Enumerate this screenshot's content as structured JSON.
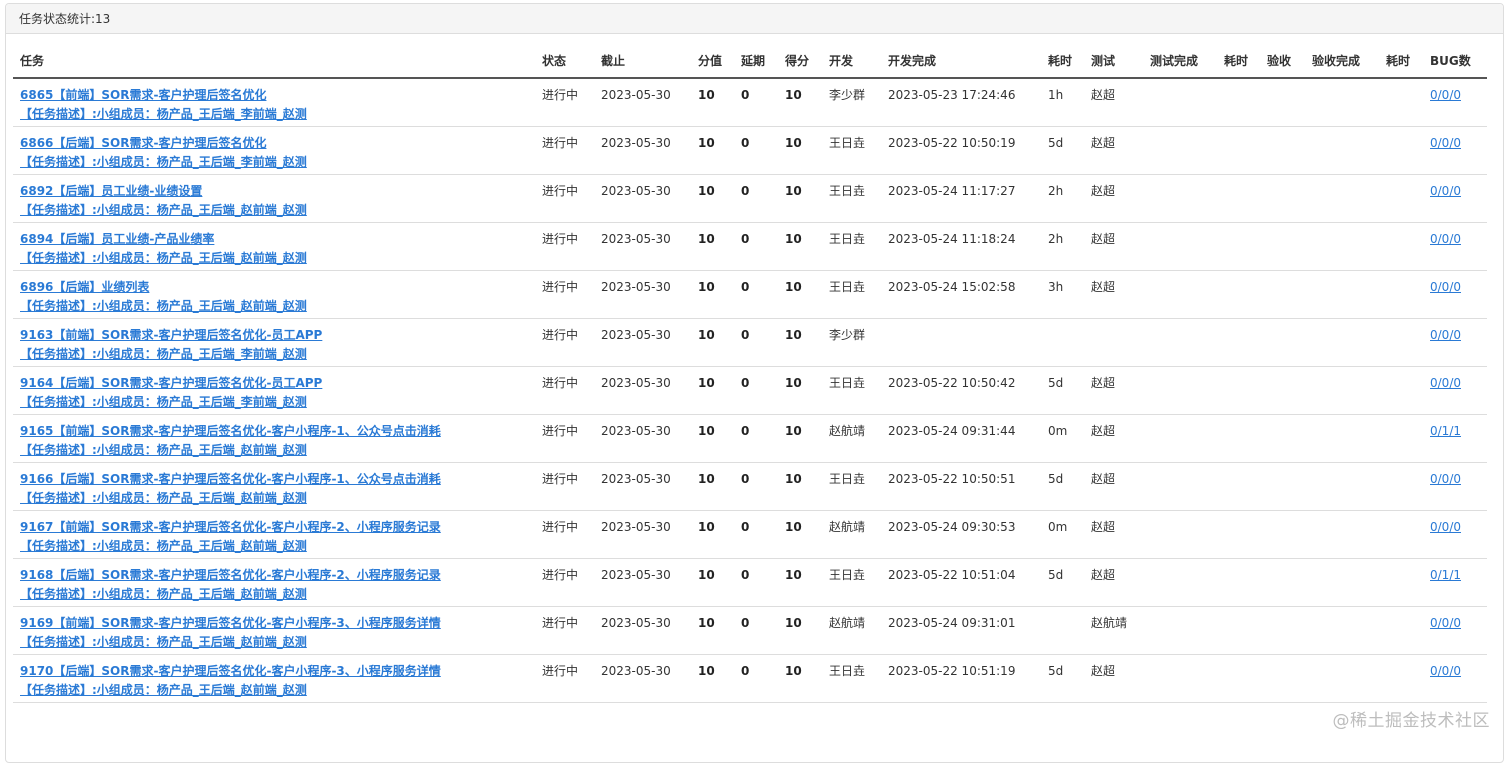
{
  "panel": {
    "title": "任务状态统计:13"
  },
  "columns": [
    "任务",
    "状态",
    "截止",
    "分值",
    "延期",
    "得分",
    "开发",
    "开发完成",
    "耗时",
    "测试",
    "测试完成",
    "耗时",
    "验收",
    "验收完成",
    "耗时",
    "BUG数"
  ],
  "rows": [
    {
      "task_title": "6865【前端】SOR需求-客户护理后签名优化",
      "task_desc": "【任务描述】:小组成员：杨产品_王后端_李前端_赵测",
      "status": "进行中",
      "deadline": "2023-05-30",
      "score_value": "10",
      "delay": "0",
      "score": "10",
      "dev": "李少群",
      "dev_done": "2023-05-23 17:24:46",
      "dev_time": "1h",
      "tester": "赵超",
      "test_done": "",
      "test_time": "",
      "accept": "",
      "accept_done": "",
      "accept_time": "",
      "bugs": "0/0/0"
    },
    {
      "task_title": "6866【后端】SOR需求-客户护理后签名优化",
      "task_desc": "【任务描述】:小组成员：杨产品_王后端_李前端_赵测",
      "status": "进行中",
      "deadline": "2023-05-30",
      "score_value": "10",
      "delay": "0",
      "score": "10",
      "dev": "王日垚",
      "dev_done": "2023-05-22 10:50:19",
      "dev_time": "5d",
      "tester": "赵超",
      "test_done": "",
      "test_time": "",
      "accept": "",
      "accept_done": "",
      "accept_time": "",
      "bugs": "0/0/0"
    },
    {
      "task_title": "6892【后端】员工业绩-业绩设置",
      "task_desc": "【任务描述】:小组成员：杨产品_王后端_赵前端_赵测",
      "status": "进行中",
      "deadline": "2023-05-30",
      "score_value": "10",
      "delay": "0",
      "score": "10",
      "dev": "王日垚",
      "dev_done": "2023-05-24 11:17:27",
      "dev_time": "2h",
      "tester": "赵超",
      "test_done": "",
      "test_time": "",
      "accept": "",
      "accept_done": "",
      "accept_time": "",
      "bugs": "0/0/0"
    },
    {
      "task_title": "6894【后端】员工业绩-产品业绩率",
      "task_desc": "【任务描述】:小组成员：杨产品_王后端_赵前端_赵测",
      "status": "进行中",
      "deadline": "2023-05-30",
      "score_value": "10",
      "delay": "0",
      "score": "10",
      "dev": "王日垚",
      "dev_done": "2023-05-24 11:18:24",
      "dev_time": "2h",
      "tester": "赵超",
      "test_done": "",
      "test_time": "",
      "accept": "",
      "accept_done": "",
      "accept_time": "",
      "bugs": "0/0/0"
    },
    {
      "task_title": "6896【后端】业绩列表",
      "task_desc": "【任务描述】:小组成员：杨产品_王后端_赵前端_赵测",
      "status": "进行中",
      "deadline": "2023-05-30",
      "score_value": "10",
      "delay": "0",
      "score": "10",
      "dev": "王日垚",
      "dev_done": "2023-05-24 15:02:58",
      "dev_time": "3h",
      "tester": "赵超",
      "test_done": "",
      "test_time": "",
      "accept": "",
      "accept_done": "",
      "accept_time": "",
      "bugs": "0/0/0"
    },
    {
      "task_title": "9163【前端】SOR需求-客户护理后签名优化-员工APP",
      "task_desc": "【任务描述】:小组成员：杨产品_王后端_李前端_赵测",
      "status": "进行中",
      "deadline": "2023-05-30",
      "score_value": "10",
      "delay": "0",
      "score": "10",
      "dev": "李少群",
      "dev_done": "",
      "dev_time": "",
      "tester": "",
      "test_done": "",
      "test_time": "",
      "accept": "",
      "accept_done": "",
      "accept_time": "",
      "bugs": "0/0/0"
    },
    {
      "task_title": "9164【后端】SOR需求-客户护理后签名优化-员工APP",
      "task_desc": "【任务描述】:小组成员：杨产品_王后端_李前端_赵测",
      "status": "进行中",
      "deadline": "2023-05-30",
      "score_value": "10",
      "delay": "0",
      "score": "10",
      "dev": "王日垚",
      "dev_done": "2023-05-22 10:50:42",
      "dev_time": "5d",
      "tester": "赵超",
      "test_done": "",
      "test_time": "",
      "accept": "",
      "accept_done": "",
      "accept_time": "",
      "bugs": "0/0/0"
    },
    {
      "task_title": "9165【前端】SOR需求-客户护理后签名优化-客户小程序-1、公众号点击消耗",
      "task_desc": "【任务描述】:小组成员：杨产品_王后端_赵前端_赵测",
      "status": "进行中",
      "deadline": "2023-05-30",
      "score_value": "10",
      "delay": "0",
      "score": "10",
      "dev": "赵航靖",
      "dev_done": "2023-05-24 09:31:44",
      "dev_time": "0m",
      "tester": "赵超",
      "test_done": "",
      "test_time": "",
      "accept": "",
      "accept_done": "",
      "accept_time": "",
      "bugs": "0/1/1"
    },
    {
      "task_title": "9166【后端】SOR需求-客户护理后签名优化-客户小程序-1、公众号点击消耗",
      "task_desc": "【任务描述】:小组成员：杨产品_王后端_赵前端_赵测",
      "status": "进行中",
      "deadline": "2023-05-30",
      "score_value": "10",
      "delay": "0",
      "score": "10",
      "dev": "王日垚",
      "dev_done": "2023-05-22 10:50:51",
      "dev_time": "5d",
      "tester": "赵超",
      "test_done": "",
      "test_time": "",
      "accept": "",
      "accept_done": "",
      "accept_time": "",
      "bugs": "0/0/0"
    },
    {
      "task_title": "9167【前端】SOR需求-客户护理后签名优化-客户小程序-2、小程序服务记录",
      "task_desc": "【任务描述】:小组成员：杨产品_王后端_赵前端_赵测",
      "status": "进行中",
      "deadline": "2023-05-30",
      "score_value": "10",
      "delay": "0",
      "score": "10",
      "dev": "赵航靖",
      "dev_done": "2023-05-24 09:30:53",
      "dev_time": "0m",
      "tester": "赵超",
      "test_done": "",
      "test_time": "",
      "accept": "",
      "accept_done": "",
      "accept_time": "",
      "bugs": "0/0/0"
    },
    {
      "task_title": "9168【后端】SOR需求-客户护理后签名优化-客户小程序-2、小程序服务记录",
      "task_desc": "【任务描述】:小组成员：杨产品_王后端_赵前端_赵测",
      "status": "进行中",
      "deadline": "2023-05-30",
      "score_value": "10",
      "delay": "0",
      "score": "10",
      "dev": "王日垚",
      "dev_done": "2023-05-22 10:51:04",
      "dev_time": "5d",
      "tester": "赵超",
      "test_done": "",
      "test_time": "",
      "accept": "",
      "accept_done": "",
      "accept_time": "",
      "bugs": "0/1/1"
    },
    {
      "task_title": "9169【前端】SOR需求-客户护理后签名优化-客户小程序-3、小程序服务详情",
      "task_desc": "【任务描述】:小组成员：杨产品_王后端_赵前端_赵测",
      "status": "进行中",
      "deadline": "2023-05-30",
      "score_value": "10",
      "delay": "0",
      "score": "10",
      "dev": "赵航靖",
      "dev_done": "2023-05-24 09:31:01",
      "dev_time": "",
      "tester": "赵航靖",
      "test_done": "",
      "test_time": "",
      "accept": "",
      "accept_done": "",
      "accept_time": "",
      "bugs": "0/0/0"
    },
    {
      "task_title": "9170【后端】SOR需求-客户护理后签名优化-客户小程序-3、小程序服务详情",
      "task_desc": "【任务描述】:小组成员：杨产品_王后端_赵前端_赵测",
      "status": "进行中",
      "deadline": "2023-05-30",
      "score_value": "10",
      "delay": "0",
      "score": "10",
      "dev": "王日垚",
      "dev_done": "2023-05-22 10:51:19",
      "dev_time": "5d",
      "tester": "赵超",
      "test_done": "",
      "test_time": "",
      "accept": "",
      "accept_done": "",
      "accept_time": "",
      "bugs": "0/0/0"
    }
  ],
  "watermark": "@稀土掘金技术社区",
  "colors": {
    "link": "#2a7ad5",
    "heading_bg": "#f5f5f5",
    "border": "#dddddd",
    "watermark": "#bdbdbd"
  }
}
